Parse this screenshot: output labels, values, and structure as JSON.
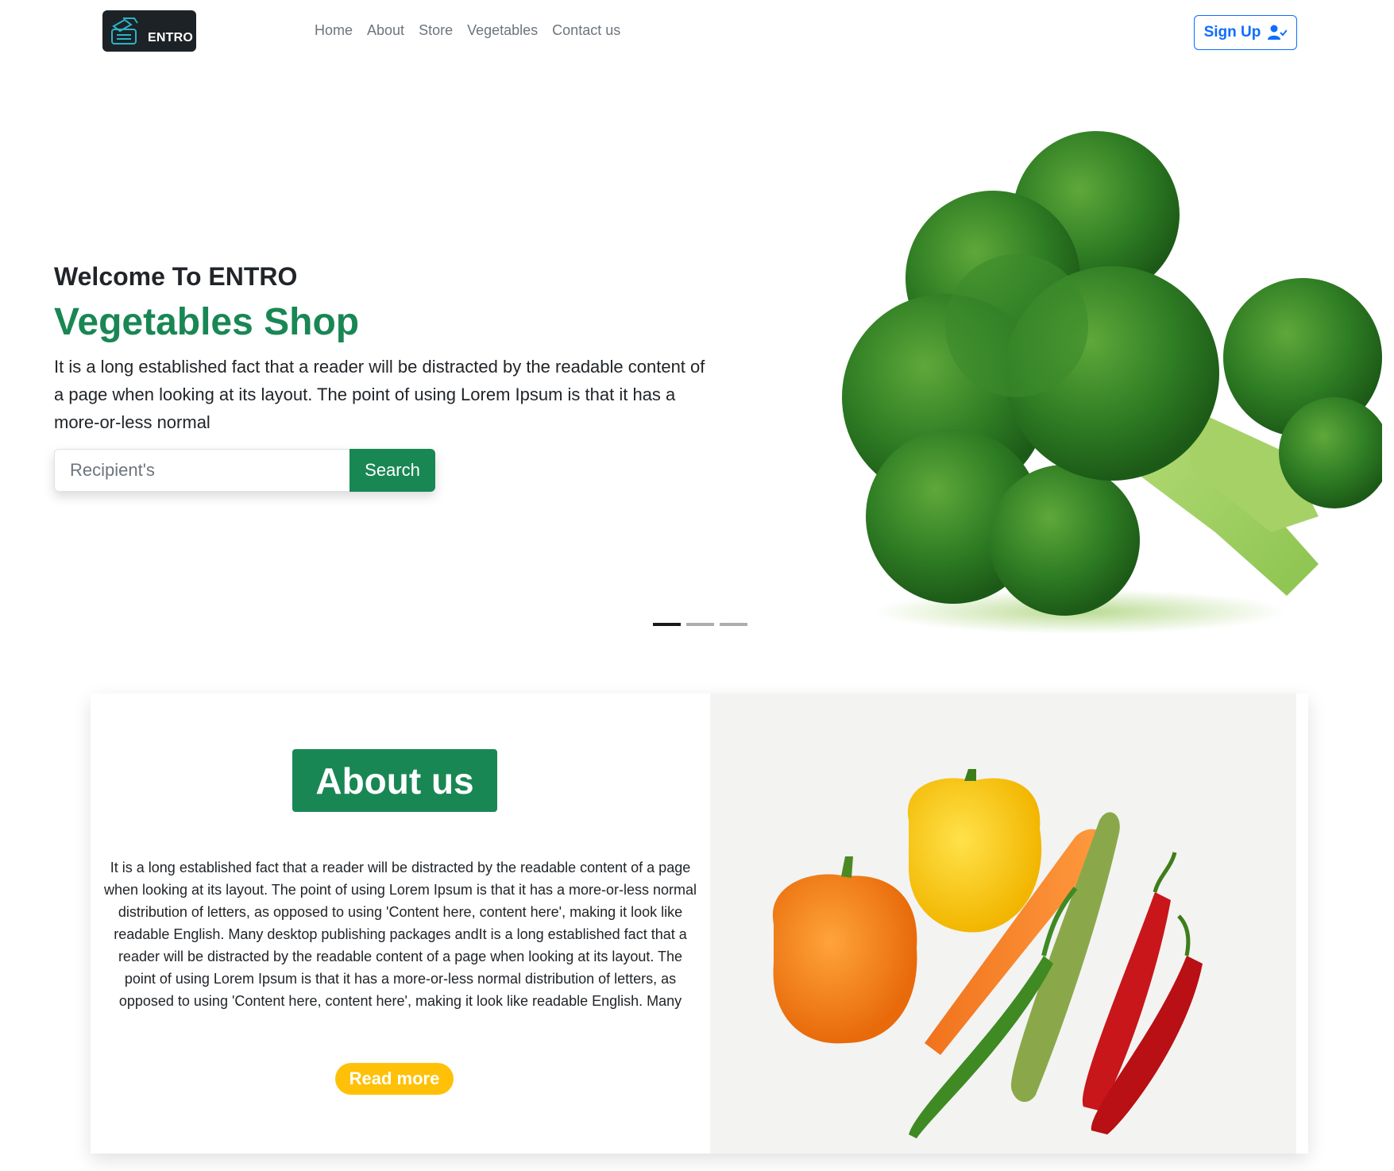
{
  "brand": {
    "name": "ENTRO"
  },
  "nav": {
    "links": [
      "Home",
      "About",
      "Store",
      "Vegetables",
      "Contact us"
    ],
    "signup_label": "Sign Up"
  },
  "hero": {
    "welcome": "Welcome To ENTRO",
    "title": "Vegetables Shop",
    "description": "It is a long established fact that a reader will be distracted by the readable content of a page when looking at its layout. The point of using Lorem Ipsum is that it has a more-or-less normal",
    "search": {
      "placeholder": "Recipient's",
      "value": "",
      "button_label": "Search"
    },
    "carousel": {
      "slides": 3,
      "active": 1
    }
  },
  "about": {
    "heading": "About us",
    "body": "It is a long established fact that a reader will be distracted by the readable content of a page when looking at its layout. The point of using Lorem Ipsum is that it has a more-or-less normal distribution of letters, as opposed to using 'Content here, content here', making it look like readable English. Many desktop publishing packages andIt is a long established fact that a reader will be distracted by the readable content of a page when looking at its layout. The point of using Lorem Ipsum is that it has a more-or-less normal distribution of letters, as opposed to using 'Content here, content here', making it look like readable English. Many",
    "read_more_label": "Read more"
  },
  "colors": {
    "primary_green": "#198754",
    "signup_blue": "#0d6efd",
    "read_more_yellow": "#ffc107",
    "logo_bg": "#1d2226"
  },
  "icons": {
    "logo": "entro-logo-icon",
    "signup": "user-check-icon"
  }
}
